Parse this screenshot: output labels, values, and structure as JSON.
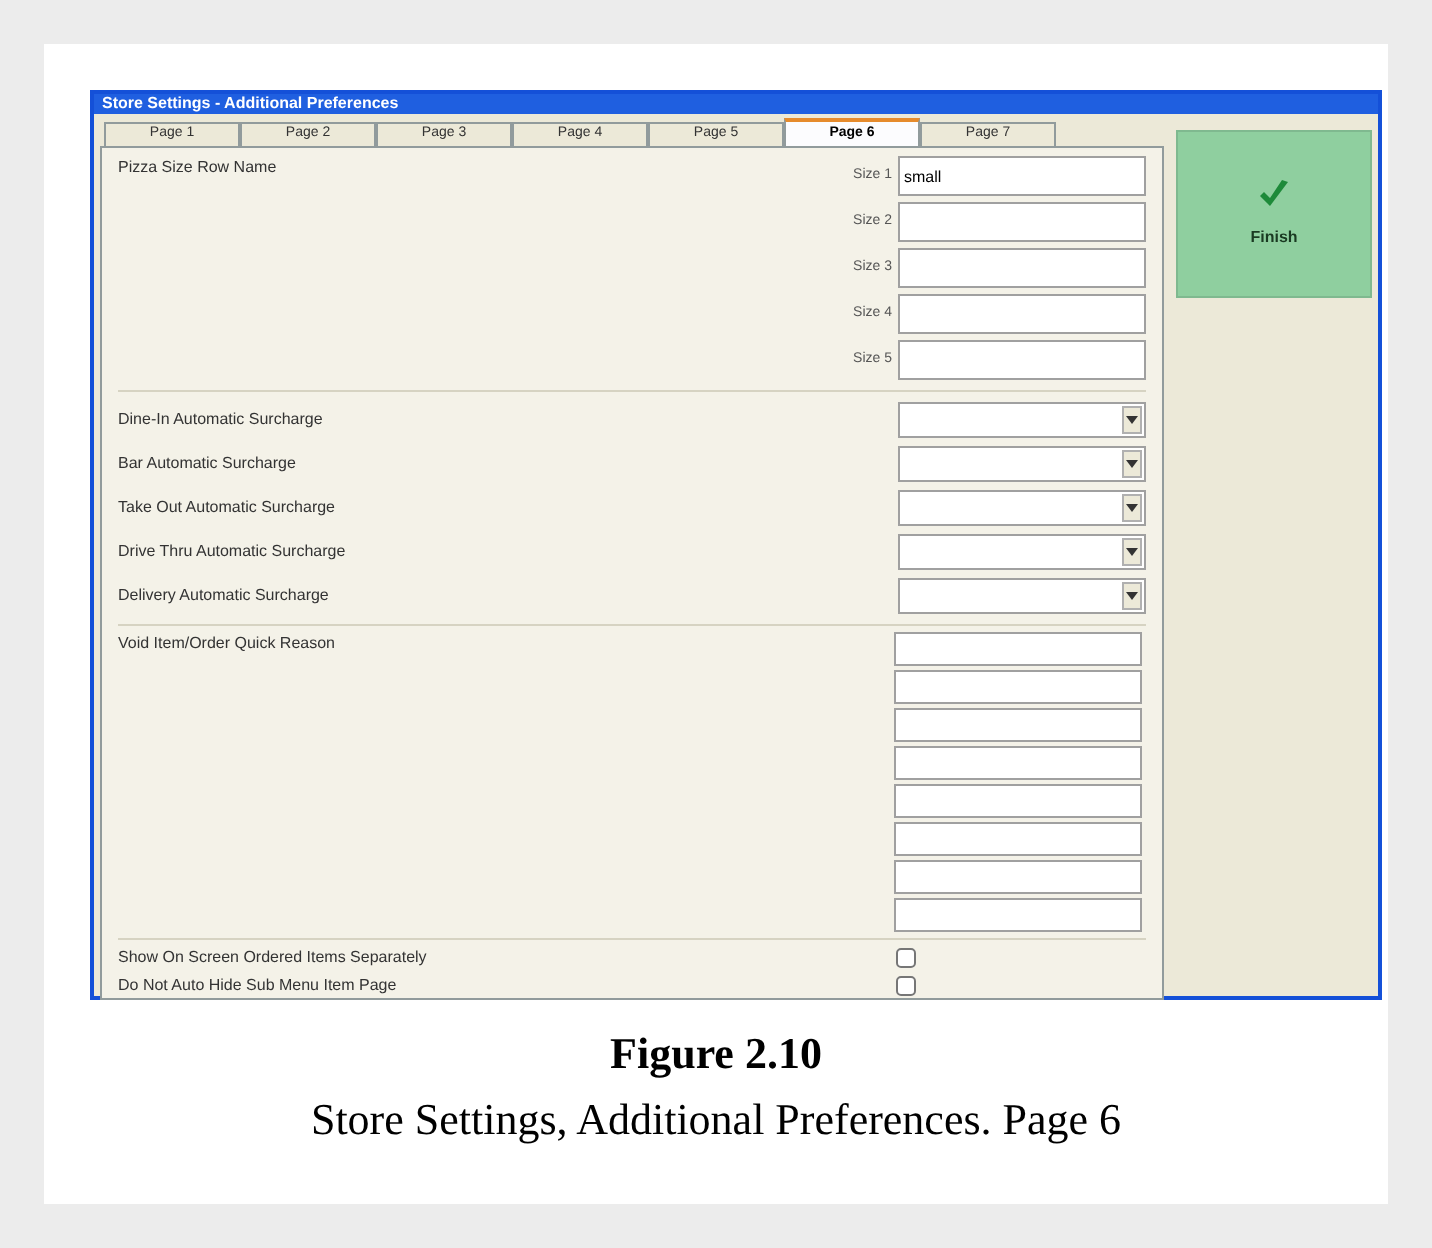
{
  "window": {
    "title": "Store Settings - Additional Preferences"
  },
  "tabs": [
    {
      "label": "Page 1",
      "selected": false
    },
    {
      "label": "Page 2",
      "selected": false
    },
    {
      "label": "Page 3",
      "selected": false
    },
    {
      "label": "Page 4",
      "selected": false
    },
    {
      "label": "Page 5",
      "selected": false
    },
    {
      "label": "Page 6",
      "selected": true
    },
    {
      "label": "Page 7",
      "selected": false
    }
  ],
  "pizza_sizes": {
    "label": "Pizza Size Row Name",
    "fields": [
      {
        "label": "Size 1",
        "value": "small"
      },
      {
        "label": "Size 2"
      },
      {
        "label": "Size 3"
      },
      {
        "label": "Size 4"
      },
      {
        "label": "Size 5"
      }
    ]
  },
  "surcharges": [
    {
      "label": "Dine-In Automatic Surcharge"
    },
    {
      "label": "Bar Automatic Surcharge"
    },
    {
      "label": "Take Out Automatic Surcharge"
    },
    {
      "label": "Drive Thru Automatic Surcharge"
    },
    {
      "label": "Delivery Automatic Surcharge"
    }
  ],
  "void_reasons": {
    "label": "Void Item/Order Quick Reason",
    "fields": [
      {
        "kind": "text"
      },
      {
        "kind": "text"
      },
      {
        "kind": "text"
      },
      {
        "kind": "text"
      },
      {
        "kind": "text"
      },
      {
        "kind": "text"
      },
      {
        "kind": "text"
      },
      {
        "kind": "text"
      }
    ]
  },
  "options": [
    {
      "label": "Show On Screen Ordered Items Separately",
      "checked": false
    },
    {
      "label": "Do Not Auto Hide Sub Menu Item Page",
      "checked": false
    }
  ],
  "finish_button": {
    "label": "Finish"
  },
  "caption": {
    "figure": "Figure 2.10",
    "text": "Store Settings, Additional Preferences. Page 6"
  }
}
